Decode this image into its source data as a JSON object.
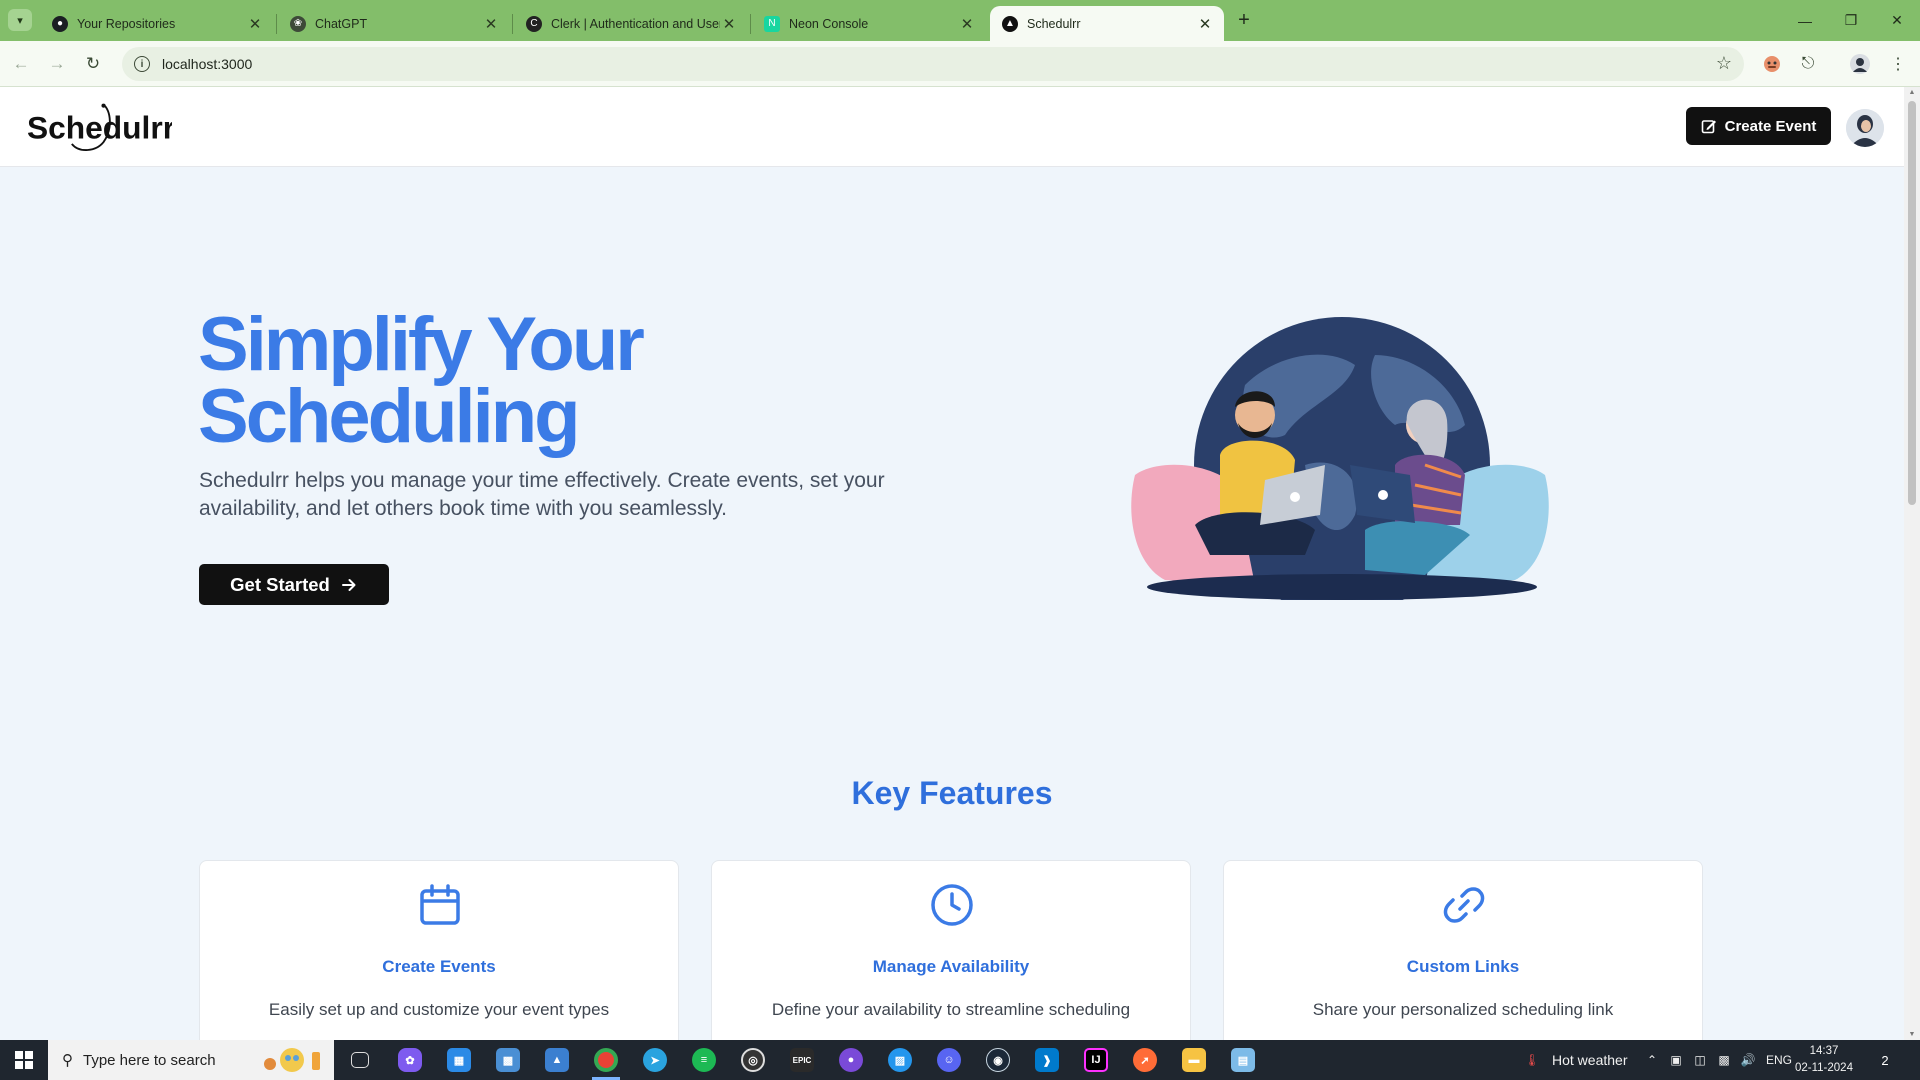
{
  "browser": {
    "tabs": [
      {
        "title": "Your Repositories",
        "icon": "github-icon"
      },
      {
        "title": "ChatGPT",
        "icon": "openai-icon"
      },
      {
        "title": "Clerk | Authentication and User",
        "icon": "clerk-icon"
      },
      {
        "title": "Neon Console",
        "icon": "neon-icon"
      },
      {
        "title": "Schedulrr",
        "icon": "schedulrr-icon",
        "active": true
      }
    ],
    "url": "localhost:3000"
  },
  "header": {
    "logo_text": "Schedulrr",
    "create_event_label": "Create Event"
  },
  "hero": {
    "title_line1": "Simplify Your",
    "title_line2": "Scheduling",
    "subtitle": "Schedulrr helps you manage your time effectively. Create events, set your availability, and let others book time with you seamlessly.",
    "cta_label": "Get Started"
  },
  "features": {
    "title": "Key Features",
    "items": [
      {
        "icon": "calendar-icon",
        "title": "Create Events",
        "description": "Easily set up and customize your event types"
      },
      {
        "icon": "clock-icon",
        "title": "Manage Availability",
        "description": "Define your availability to streamline scheduling"
      },
      {
        "icon": "link-icon",
        "title": "Custom Links",
        "description": "Share your personalized scheduling link"
      }
    ]
  },
  "taskbar": {
    "search_placeholder": "Type here to search",
    "weather": "Hot weather",
    "language": "ENG",
    "time": "14:37",
    "date": "02-11-2024",
    "notification_count": "2"
  },
  "colors": {
    "accent": "#3b7be6",
    "tab_strip": "#83be6a",
    "page_bg": "#eff5fb"
  }
}
